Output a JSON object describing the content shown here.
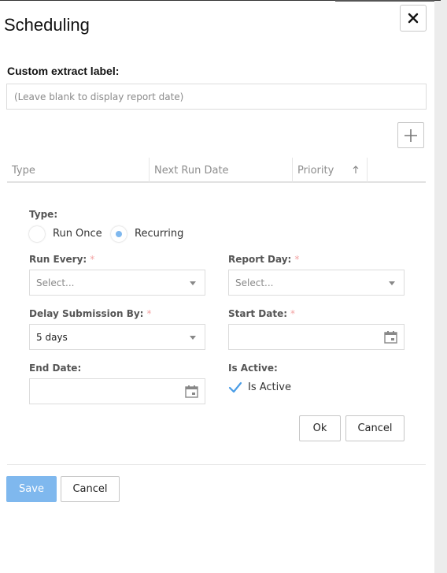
{
  "dialog": {
    "title": "Scheduling",
    "close_icon": "close-icon"
  },
  "custom_label": {
    "label": "Custom extract label:",
    "placeholder": "(Leave blank to display report date)",
    "value": ""
  },
  "grid": {
    "add_icon": "plus-icon",
    "columns": [
      "Type",
      "Next Run Date",
      "Priority",
      ""
    ],
    "sort_icon": "arrow-up-icon"
  },
  "form": {
    "type_label": "Type:",
    "type_options": [
      "Run Once",
      "Recurring"
    ],
    "type_selected": "Recurring",
    "run_every": {
      "label": "Run Every:",
      "required": "*",
      "placeholder": "Select..."
    },
    "report_day": {
      "label": "Report Day:",
      "required": "*",
      "placeholder": "Select..."
    },
    "delay_submission": {
      "label": "Delay Submission By:",
      "required": "*",
      "value": "5 days"
    },
    "start_date": {
      "label": "Start Date:",
      "required": "*",
      "value": ""
    },
    "end_date": {
      "label": "End Date:",
      "value": ""
    },
    "is_active": {
      "label": "Is Active:",
      "checkbox_label": "Is Active",
      "checked": true
    },
    "ok_label": "Ok",
    "cancel_label": "Cancel"
  },
  "footer": {
    "save_label": "Save",
    "cancel_label": "Cancel"
  },
  "colors": {
    "accent": "#7fb8ee",
    "required": "#f3a3a3"
  }
}
